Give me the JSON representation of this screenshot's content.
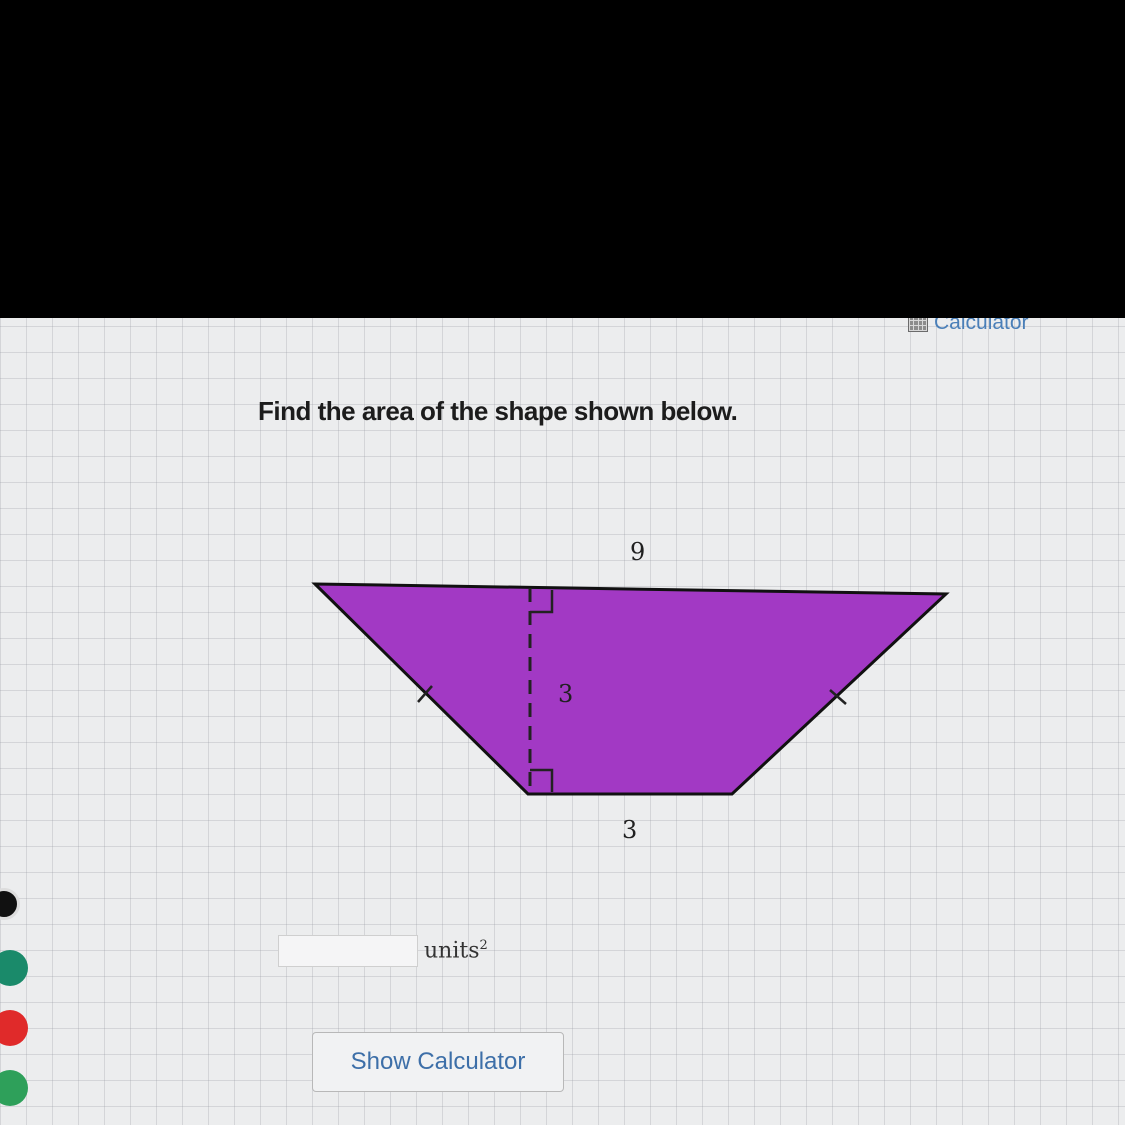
{
  "header": {
    "calculator_label": "Calculator"
  },
  "question": {
    "text": "Find the area of the shape shown below."
  },
  "figure": {
    "top_base_label": "9",
    "height_label": "3",
    "bottom_base_label": "3",
    "fill_color": "#a239c4"
  },
  "answer": {
    "value": "",
    "units_label": "units",
    "units_exponent": "2"
  },
  "buttons": {
    "show_calculator_label": "Show Calculator"
  },
  "colors": {
    "sidebar_teal": "#1a8a6a",
    "sidebar_red": "#e02a2a",
    "sidebar_green": "#2ea05a",
    "sidebar_blue": "#5b8fc8"
  }
}
